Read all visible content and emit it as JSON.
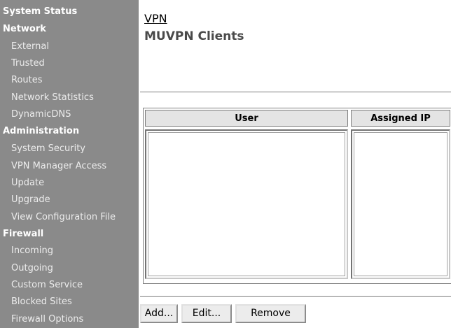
{
  "sidebar": {
    "items": [
      {
        "label": "System Status",
        "type": "section"
      },
      {
        "label": "Network",
        "type": "section"
      },
      {
        "label": "External",
        "type": "sub"
      },
      {
        "label": "Trusted",
        "type": "sub"
      },
      {
        "label": "Routes",
        "type": "sub"
      },
      {
        "label": "Network Statistics",
        "type": "sub"
      },
      {
        "label": "DynamicDNS",
        "type": "sub"
      },
      {
        "label": "Administration",
        "type": "section"
      },
      {
        "label": "System Security",
        "type": "sub"
      },
      {
        "label": "VPN Manager Access",
        "type": "sub"
      },
      {
        "label": "Update",
        "type": "sub"
      },
      {
        "label": "Upgrade",
        "type": "sub"
      },
      {
        "label": "View Configuration File",
        "type": "sub"
      },
      {
        "label": "Firewall",
        "type": "section"
      },
      {
        "label": "Incoming",
        "type": "sub"
      },
      {
        "label": "Outgoing",
        "type": "sub"
      },
      {
        "label": "Custom Service",
        "type": "sub"
      },
      {
        "label": "Blocked Sites",
        "type": "sub"
      },
      {
        "label": "Firewall Options",
        "type": "sub"
      }
    ]
  },
  "header": {
    "breadcrumb": "VPN",
    "title": "MUVPN Clients"
  },
  "table": {
    "columns": [
      "User",
      "Assigned IP"
    ]
  },
  "buttons": {
    "add": "Add...",
    "edit": "Edit...",
    "remove": "Remove"
  },
  "colors": {
    "sidebar_bg": "#8a8a8a",
    "sidebar_text": "#ffffff",
    "title_text": "#4a4a4a"
  }
}
